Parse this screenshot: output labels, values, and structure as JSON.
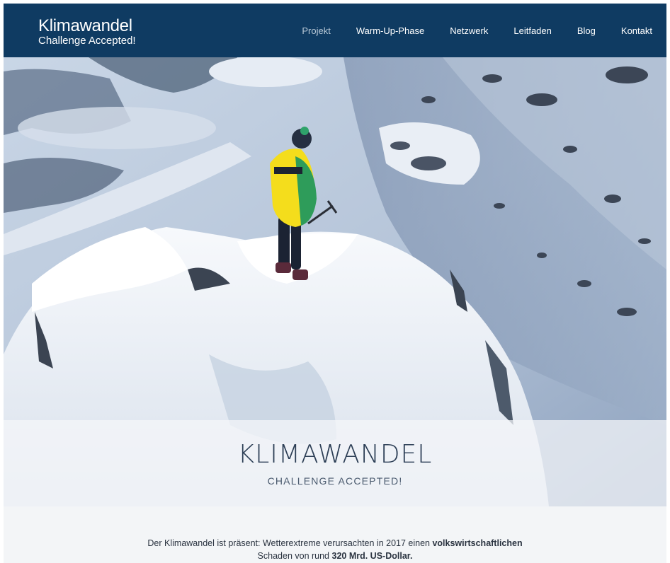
{
  "logo": {
    "title": "Klimawandel",
    "subtitle": "Challenge Accepted!"
  },
  "nav": {
    "items": [
      {
        "label": "Projekt",
        "active": true
      },
      {
        "label": "Warm-Up-Phase"
      },
      {
        "label": "Netzwerk"
      },
      {
        "label": "Leitfaden"
      },
      {
        "label": "Blog"
      },
      {
        "label": "Kontakt"
      }
    ]
  },
  "hero": {
    "title": "KLIMAWANDEL",
    "subtitle": "CHALLENGE ACCEPTED!"
  },
  "intro": {
    "line1_prefix": "Der Klimawandel ist präsent: Wetterextreme verursachten in 2017 einen ",
    "line1_bold": "volkswirtschaftlichen",
    "line2_prefix": "Schaden von rund ",
    "line2_bold": "320 Mrd. US-Dollar."
  },
  "colors": {
    "header_bg": "#0f3b62",
    "nav_active": "#b8c8d6",
    "banner_text": "#2c3e55"
  }
}
